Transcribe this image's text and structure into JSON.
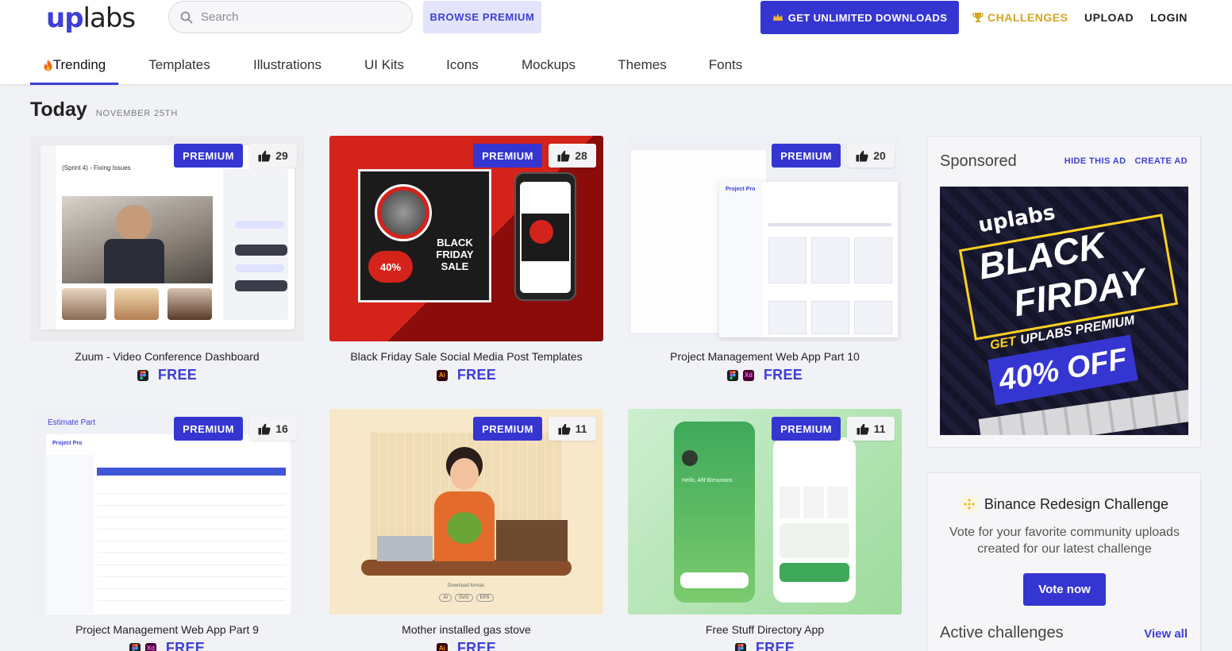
{
  "brand": {
    "logo_up": "up",
    "logo_labs": "labs",
    "accent": "#3d3fd6"
  },
  "search": {
    "placeholder": "Search"
  },
  "header": {
    "browse_premium": "BROWSE PREMIUM",
    "unlimited": "GET UNLIMITED DOWNLOADS",
    "challenges": "CHALLENGES",
    "upload": "UPLOAD",
    "login": "LOGIN"
  },
  "tabs": [
    "Trending",
    "Templates",
    "Illustrations",
    "UI Kits",
    "Icons",
    "Mockups",
    "Themes",
    "Fonts"
  ],
  "section": {
    "title": "Today",
    "date": "NOVEMBER 25TH"
  },
  "cards": [
    {
      "title": "Zuum - Video Conference Dashboard",
      "badge": "PREMIUM",
      "likes": "29",
      "price": "FREE",
      "tools": [
        "figma"
      ],
      "thumb_text": "(Sprint 4) - Fixing Issues"
    },
    {
      "title": "Black Friday Sale Social Media Post Templates",
      "badge": "PREMIUM",
      "likes": "28",
      "price": "FREE",
      "tools": [
        "ai"
      ],
      "thumb_text": "BLACK FRIDAY SALE",
      "thumb_pct": "40%"
    },
    {
      "title": "Project Management Web App Part 10",
      "badge": "PREMIUM",
      "likes": "20",
      "price": "FREE",
      "tools": [
        "figma",
        "xd"
      ],
      "thumb_text": "Project Pro"
    },
    {
      "title": "Project Management Web App Part 9",
      "badge": "PREMIUM",
      "likes": "16",
      "price": "FREE",
      "tools": [
        "figma",
        "xd"
      ],
      "thumb_text": "Estimate Part",
      "thumb_sub": "Project Pro"
    },
    {
      "title": "Mother installed gas stove",
      "badge": "PREMIUM",
      "likes": "11",
      "price": "FREE",
      "tools": [
        "ai"
      ],
      "thumb_text": "Download format:",
      "formats": [
        "AI",
        "SVG",
        "EPS"
      ]
    },
    {
      "title": "Free Stuff Directory App",
      "badge": "PREMIUM",
      "likes": "11",
      "price": "FREE",
      "tools": [
        "figma"
      ],
      "thumb_text": "Hello, Afif Bimantara"
    }
  ],
  "tool_labels": {
    "ai": "Ai",
    "xd": "Xd"
  },
  "sponsored": {
    "title": "Sponsored",
    "hide": "HIDE THIS AD",
    "create": "CREATE AD",
    "ad_logo": "uplabs",
    "ad_line1": "BLACK",
    "ad_line2": "FIRDAY",
    "ad_get": "GET",
    "ad_premium": "UPLABS PREMIUM",
    "ad_off": "40% OFF"
  },
  "challenge": {
    "title": "Binance Redesign Challenge",
    "description": "Vote for your favorite community uploads created for our latest challenge",
    "vote": "Vote now",
    "active": "Active challenges",
    "view_all": "View all"
  }
}
